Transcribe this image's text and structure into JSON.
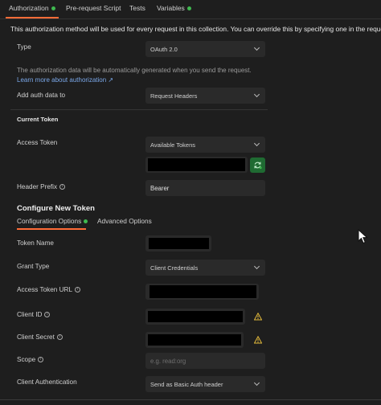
{
  "tabs": [
    {
      "label": "Authorization",
      "active": true,
      "dot": true
    },
    {
      "label": "Pre-request Script",
      "active": false,
      "dot": false
    },
    {
      "label": "Tests",
      "active": false,
      "dot": false
    },
    {
      "label": "Variables",
      "active": false,
      "dot": true
    }
  ],
  "info_text": "This authorization method will be used for every request in this collection. You can override this by specifying one in the request.",
  "type": {
    "label": "Type",
    "value": "OAuth 2.0"
  },
  "auto_text": "The authorization data will be automatically generated when you send the request.",
  "learn_more": "Learn more about authorization ↗",
  "add_auth": {
    "label": "Add auth data to",
    "value": "Request Headers"
  },
  "current_token": {
    "title": "Current Token",
    "access_token_label": "Access Token",
    "available_tokens": "Available Tokens",
    "header_prefix_label": "Header Prefix",
    "header_prefix_value": "Bearer"
  },
  "configure": {
    "title": "Configure New Token",
    "subtabs": [
      {
        "label": "Configuration Options",
        "active": true,
        "dot": true
      },
      {
        "label": "Advanced Options",
        "active": false,
        "dot": false
      }
    ],
    "token_name_label": "Token Name",
    "grant_type_label": "Grant Type",
    "grant_type_value": "Client Credentials",
    "access_token_url_label": "Access Token URL",
    "client_id_label": "Client ID",
    "client_secret_label": "Client Secret",
    "scope_label": "Scope",
    "scope_placeholder": "e.g. read:org",
    "client_auth_label": "Client Authentication",
    "client_auth_value": "Send as Basic Auth header"
  },
  "colors": {
    "accent": "#ff6c37",
    "dot": "#3fb950",
    "link": "#7aa7e8",
    "warn": "#e2b93b"
  }
}
